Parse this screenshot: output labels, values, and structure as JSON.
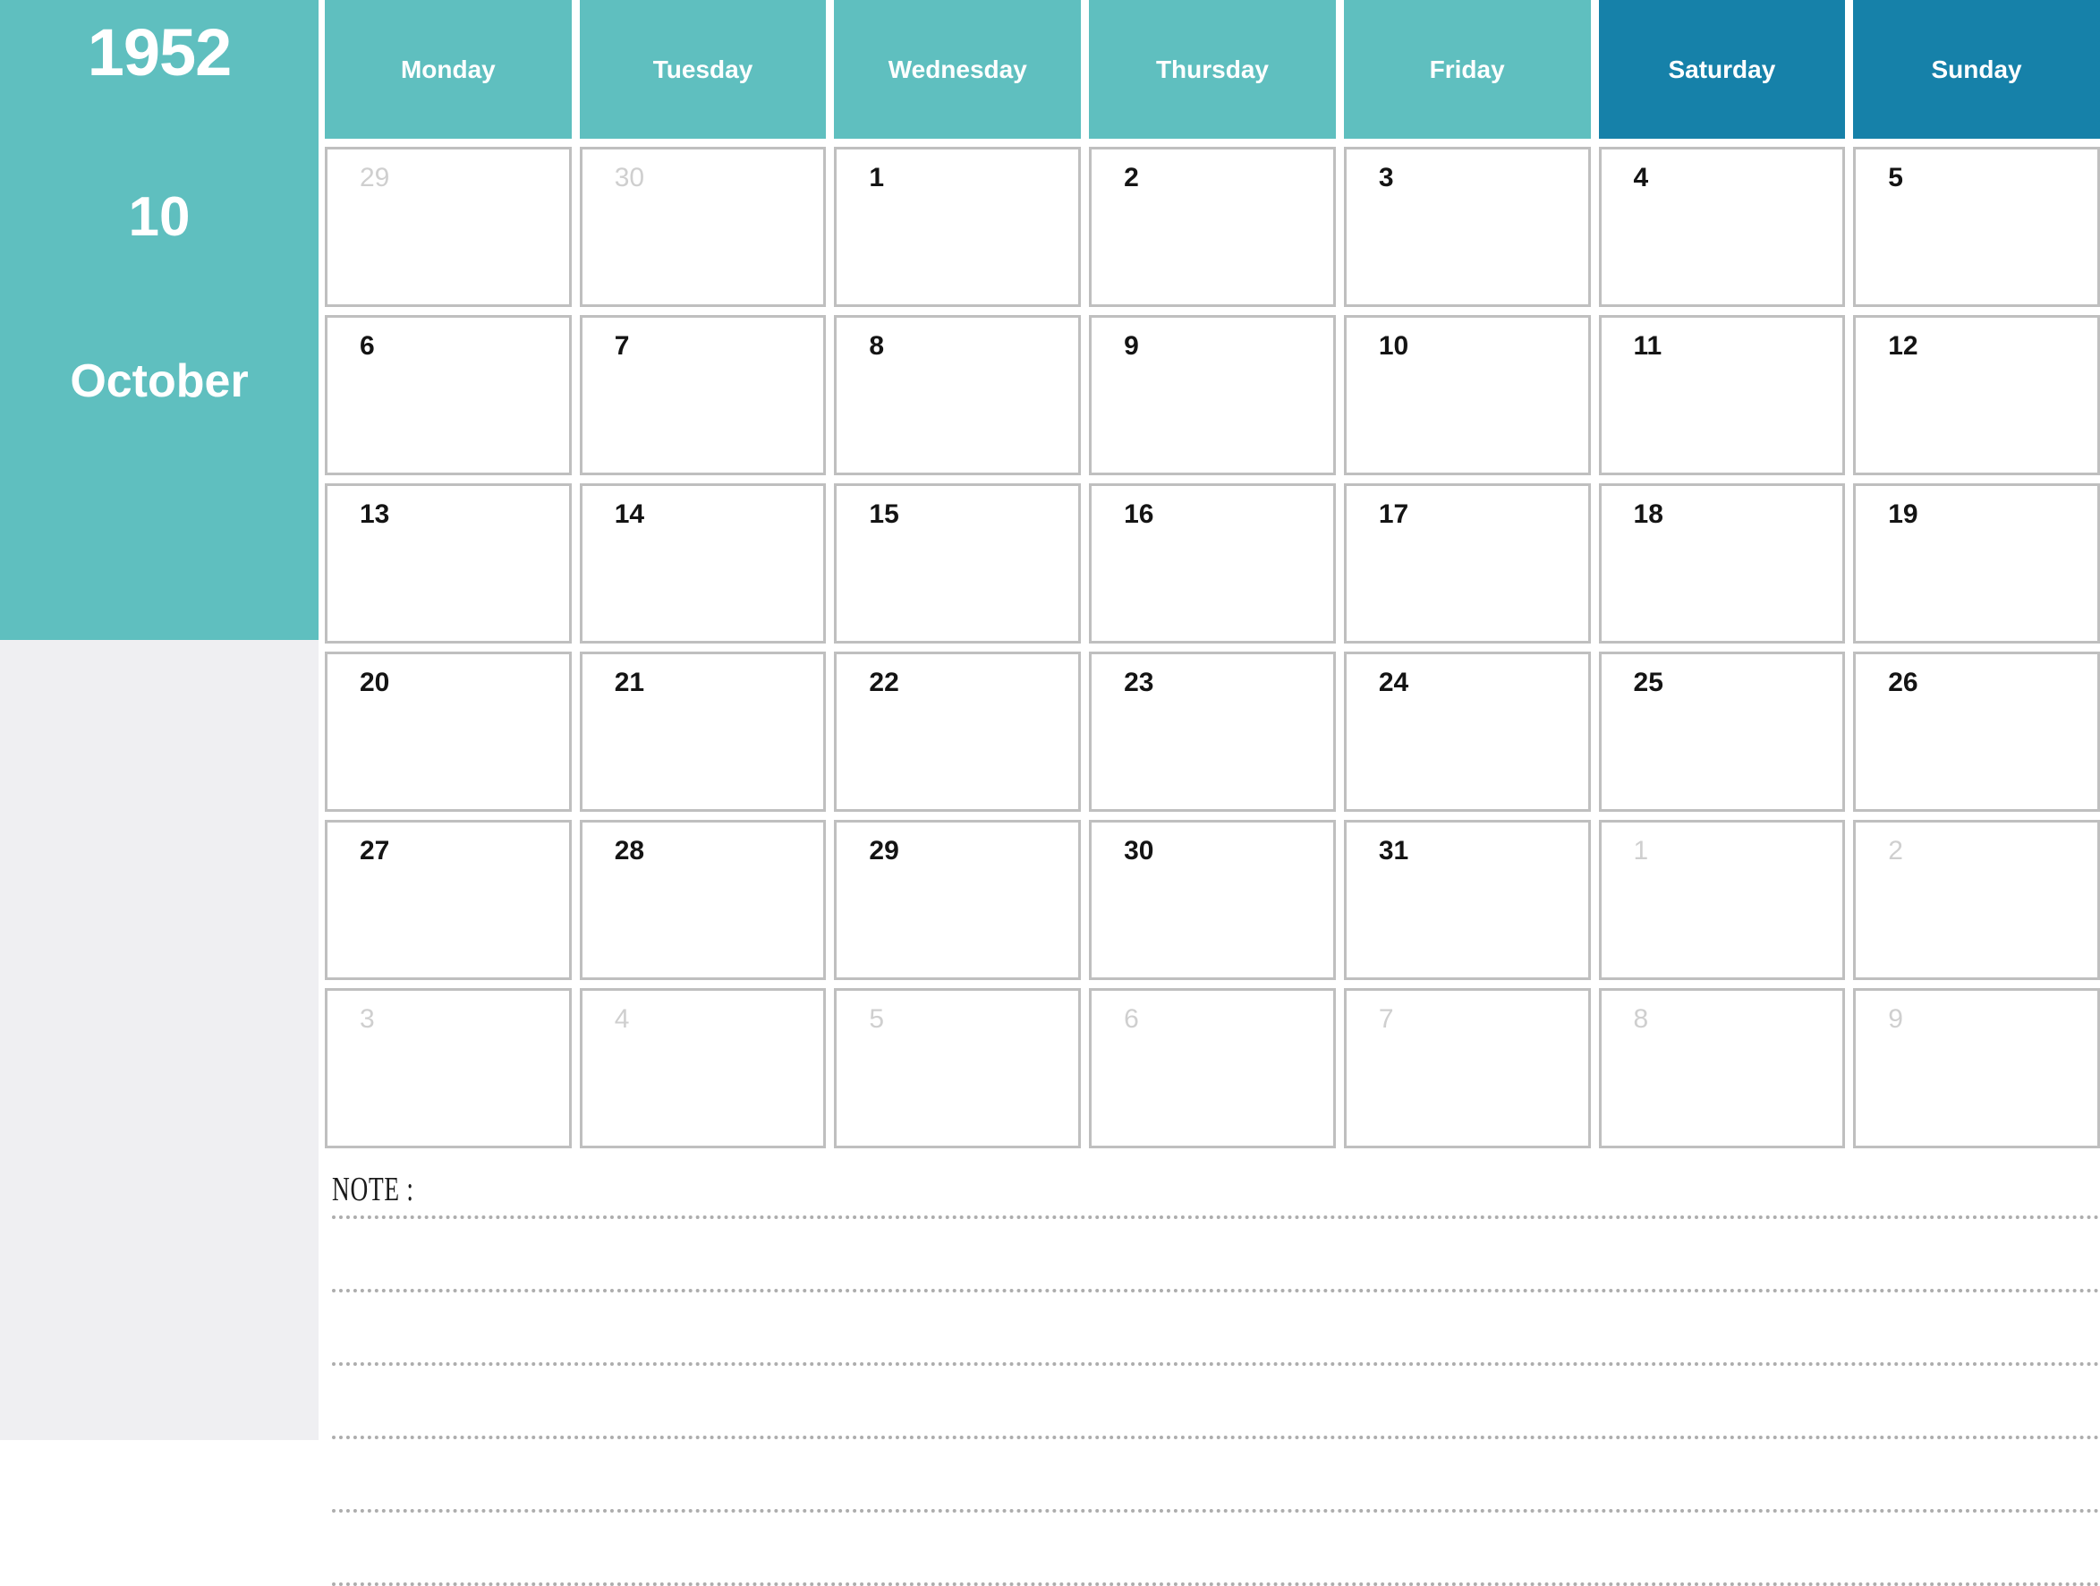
{
  "sidebar": {
    "year": "1952",
    "month_number": "10",
    "month_name": "October"
  },
  "colors": {
    "weekday_header": "#5FBFBF",
    "weekend_header": "#1681A9",
    "sidebar": "#5FBFBF",
    "sidebar_under": "#EFEFF2",
    "cell_border": "#BFBFBF",
    "in_month_text": "#141414",
    "out_month_text": "#CFCFCF"
  },
  "header": {
    "days": [
      {
        "label": "Monday",
        "weekend": false
      },
      {
        "label": "Tuesday",
        "weekend": false
      },
      {
        "label": "Wednesday",
        "weekend": false
      },
      {
        "label": "Thursday",
        "weekend": false
      },
      {
        "label": "Friday",
        "weekend": false
      },
      {
        "label": "Saturday",
        "weekend": true
      },
      {
        "label": "Sunday",
        "weekend": true
      }
    ]
  },
  "weeks": [
    [
      {
        "day": "29",
        "in_month": false
      },
      {
        "day": "30",
        "in_month": false
      },
      {
        "day": "1",
        "in_month": true
      },
      {
        "day": "2",
        "in_month": true
      },
      {
        "day": "3",
        "in_month": true
      },
      {
        "day": "4",
        "in_month": true
      },
      {
        "day": "5",
        "in_month": true
      }
    ],
    [
      {
        "day": "6",
        "in_month": true
      },
      {
        "day": "7",
        "in_month": true
      },
      {
        "day": "8",
        "in_month": true
      },
      {
        "day": "9",
        "in_month": true
      },
      {
        "day": "10",
        "in_month": true
      },
      {
        "day": "11",
        "in_month": true
      },
      {
        "day": "12",
        "in_month": true
      }
    ],
    [
      {
        "day": "13",
        "in_month": true
      },
      {
        "day": "14",
        "in_month": true
      },
      {
        "day": "15",
        "in_month": true
      },
      {
        "day": "16",
        "in_month": true
      },
      {
        "day": "17",
        "in_month": true
      },
      {
        "day": "18",
        "in_month": true
      },
      {
        "day": "19",
        "in_month": true
      }
    ],
    [
      {
        "day": "20",
        "in_month": true
      },
      {
        "day": "21",
        "in_month": true
      },
      {
        "day": "22",
        "in_month": true
      },
      {
        "day": "23",
        "in_month": true
      },
      {
        "day": "24",
        "in_month": true
      },
      {
        "day": "25",
        "in_month": true
      },
      {
        "day": "26",
        "in_month": true
      }
    ],
    [
      {
        "day": "27",
        "in_month": true
      },
      {
        "day": "28",
        "in_month": true
      },
      {
        "day": "29",
        "in_month": true
      },
      {
        "day": "30",
        "in_month": true
      },
      {
        "day": "31",
        "in_month": true
      },
      {
        "day": "1",
        "in_month": false
      },
      {
        "day": "2",
        "in_month": false
      }
    ],
    [
      {
        "day": "3",
        "in_month": false
      },
      {
        "day": "4",
        "in_month": false
      },
      {
        "day": "5",
        "in_month": false
      },
      {
        "day": "6",
        "in_month": false
      },
      {
        "day": "7",
        "in_month": false
      },
      {
        "day": "8",
        "in_month": false
      },
      {
        "day": "9",
        "in_month": false
      }
    ]
  ],
  "note": {
    "label": "NOTE :",
    "line_count": 6
  }
}
